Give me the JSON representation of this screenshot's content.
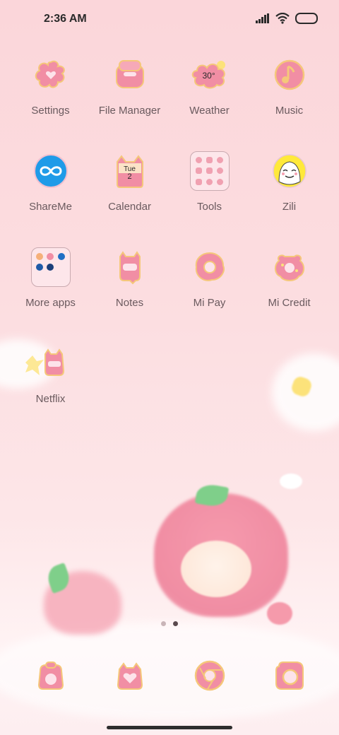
{
  "status_bar": {
    "time": "2:36 AM"
  },
  "apps": [
    {
      "id": "settings",
      "label": "Settings",
      "icon": "flower-heart-icon"
    },
    {
      "id": "file-manager",
      "label": "File Manager",
      "icon": "bag-icon"
    },
    {
      "id": "weather",
      "label": "Weather",
      "icon": "weather-cloud-icon",
      "badge": "30°"
    },
    {
      "id": "music",
      "label": "Music",
      "icon": "music-note-icon"
    },
    {
      "id": "shareme",
      "label": "ShareMe",
      "icon": "infinity-icon"
    },
    {
      "id": "calendar",
      "label": "Calendar",
      "icon": "calendar-icon",
      "day": "Tue",
      "date": "2"
    },
    {
      "id": "tools",
      "label": "Tools",
      "icon": "folder-icon"
    },
    {
      "id": "zili",
      "label": "Zili",
      "icon": "smiley-face-icon"
    },
    {
      "id": "more-apps",
      "label": "More apps",
      "icon": "folder-icon"
    },
    {
      "id": "notes",
      "label": "Notes",
      "icon": "ghost-icon"
    },
    {
      "id": "mi-pay",
      "label": "Mi Pay",
      "icon": "donut-icon"
    },
    {
      "id": "mi-credit",
      "label": "Mi Credit",
      "icon": "candy-icon"
    },
    {
      "id": "netflix",
      "label": "Netflix",
      "icon": "bee-icon"
    }
  ],
  "dock": [
    {
      "id": "phone",
      "icon": "phone-icon"
    },
    {
      "id": "messages",
      "icon": "heart-icon"
    },
    {
      "id": "browser",
      "icon": "browser-icon"
    },
    {
      "id": "camera",
      "icon": "camera-icon"
    }
  ],
  "pager": {
    "pages": 2,
    "active": 2
  },
  "colors": {
    "icon_fill": "#f18ea4",
    "icon_outline": "#f5c77a",
    "shareme_blue": "#1f9be8",
    "zili_yellow": "#ffe93a"
  }
}
